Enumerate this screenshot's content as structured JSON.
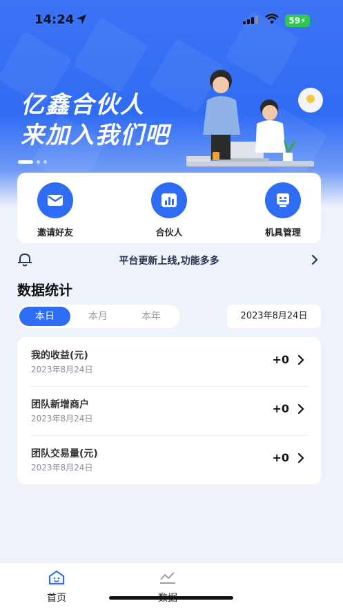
{
  "status": {
    "time": "14:24",
    "battery": "59"
  },
  "banner": {
    "line1": "亿鑫合伙人",
    "line2": "来加入我们吧"
  },
  "quick_actions": [
    {
      "label": "邀请好友",
      "icon": "mail-icon"
    },
    {
      "label": "合伙人",
      "icon": "bar-chart-icon"
    },
    {
      "label": "机具管理",
      "icon": "device-icon"
    }
  ],
  "notice": {
    "text": "平台更新上线,功能多多"
  },
  "stats": {
    "title": "数据统计",
    "tabs": [
      "本日",
      "本月",
      "本年"
    ],
    "active_tab": "本日",
    "date": "2023年8月24日",
    "rows": [
      {
        "title": "我的收益(元)",
        "date": "2023年8月24日",
        "value": "+0"
      },
      {
        "title": "团队新增商户",
        "date": "2023年8月24日",
        "value": "+0"
      },
      {
        "title": "团队交易量(元)",
        "date": "2023年8月24日",
        "value": "+0"
      }
    ]
  },
  "tabbar": [
    {
      "label": "首页",
      "active": true
    },
    {
      "label": "数据",
      "active": false
    }
  ],
  "colors": {
    "accent": "#2f6cf4",
    "background": "#eef2fb"
  }
}
